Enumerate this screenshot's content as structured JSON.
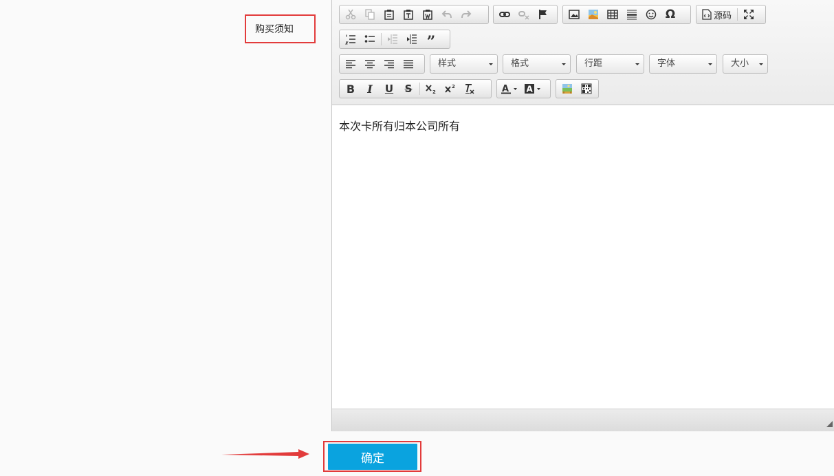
{
  "field": {
    "label": "购买须知"
  },
  "toolbar": {
    "source_label": "源码",
    "combos": {
      "style": "样式",
      "format": "格式",
      "line_height": "行距",
      "font": "字体",
      "size": "大小"
    },
    "bold": "B",
    "italic": "I",
    "underline": "U",
    "strike": "S"
  },
  "editor": {
    "content": "本次卡所有归本公司所有"
  },
  "actions": {
    "confirm": "确定"
  },
  "colors": {
    "highlight_border": "#e23b3b",
    "confirm_bg": "#0aa3df"
  }
}
